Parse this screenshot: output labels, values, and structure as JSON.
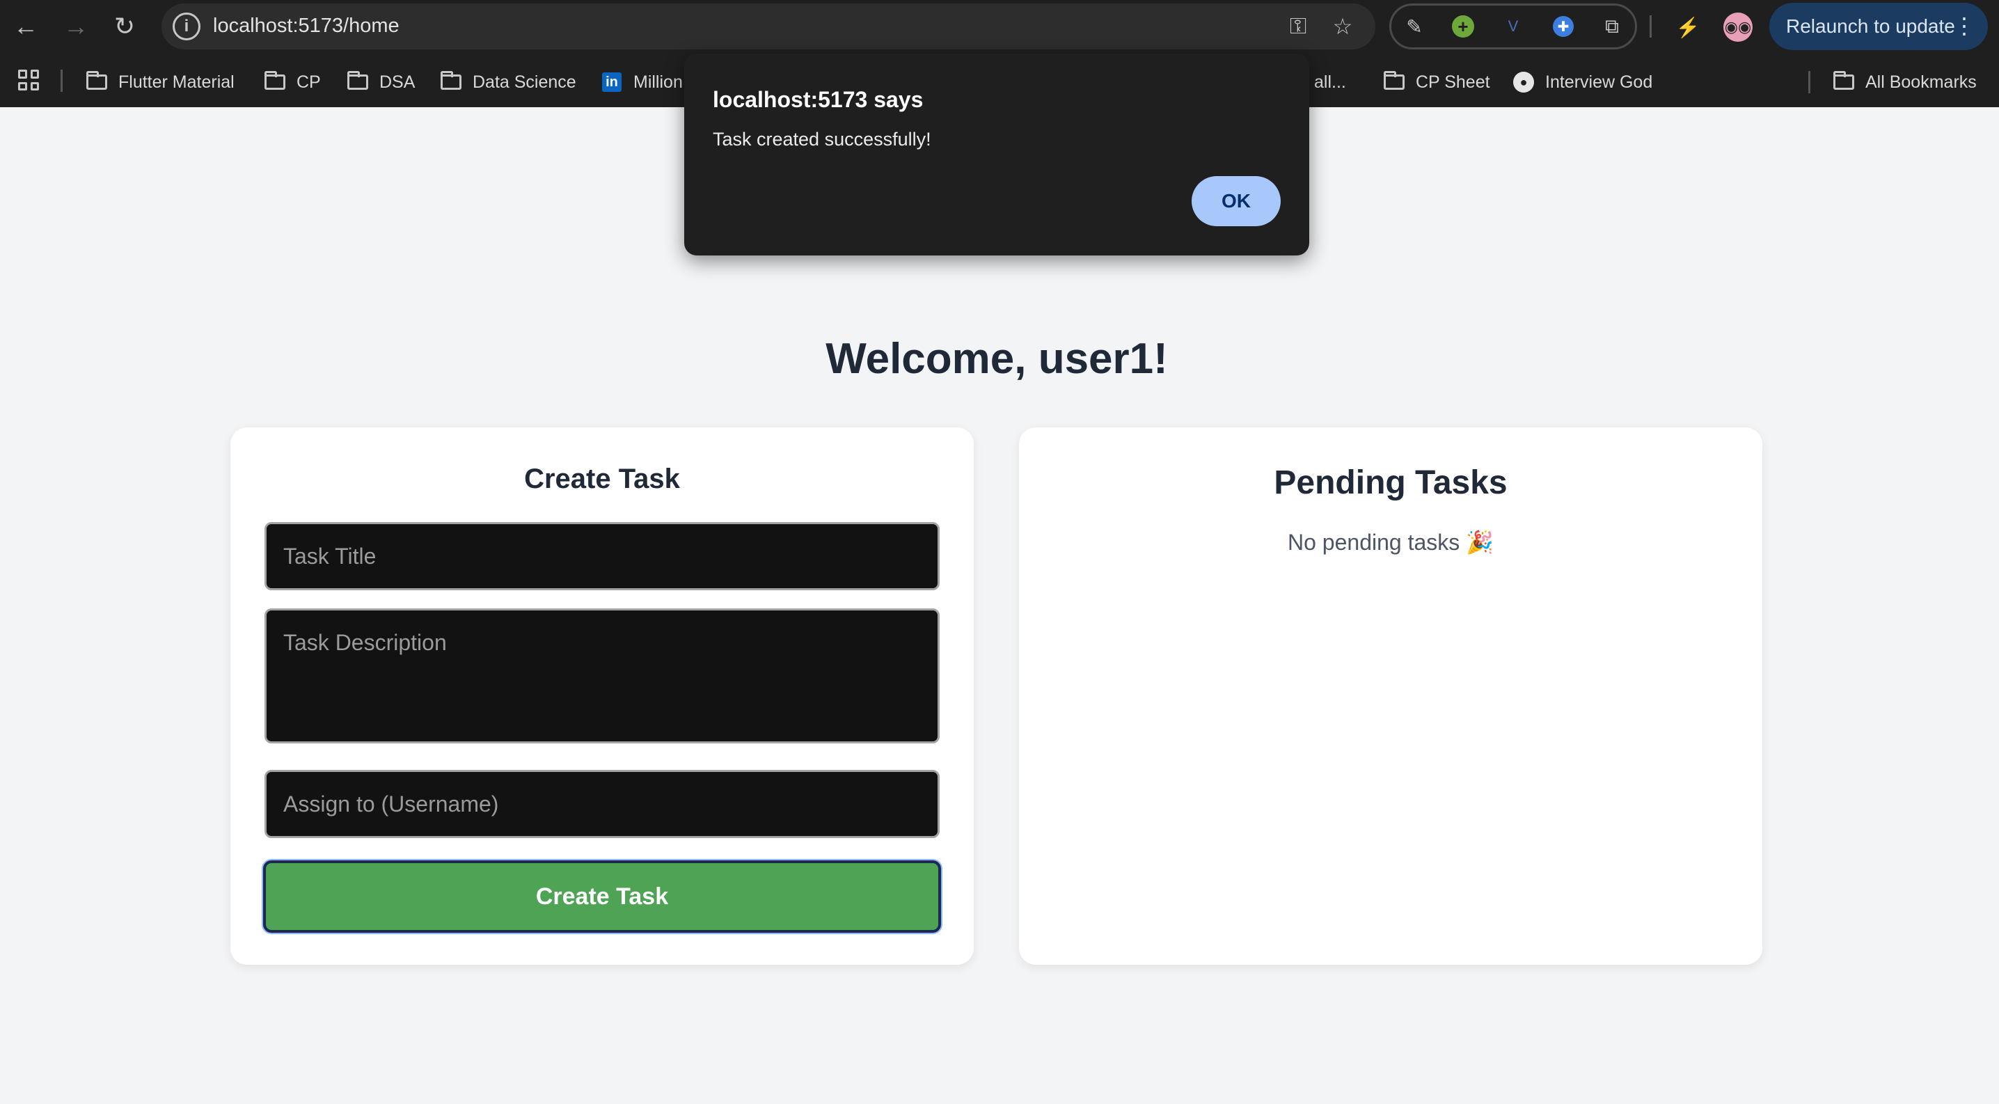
{
  "browser": {
    "url": "localhost:5173/home",
    "relaunch_label": "Relaunch to update",
    "bookmarks": [
      {
        "label": "Flutter Material",
        "icon": "folder-icon"
      },
      {
        "label": "CP",
        "icon": "folder-icon"
      },
      {
        "label": "DSA",
        "icon": "folder-icon"
      },
      {
        "label": "Data Science",
        "icon": "folder-icon"
      },
      {
        "label": "Million",
        "icon": "linkedin-icon"
      },
      {
        "label": "all...",
        "icon": "none"
      },
      {
        "label": "CP Sheet",
        "icon": "folder-icon"
      },
      {
        "label": "Interview God",
        "icon": "github-icon"
      }
    ],
    "all_bookmarks_label": "All Bookmarks"
  },
  "dialog": {
    "title": "localhost:5173 says",
    "message": "Task created successfully!",
    "ok_label": "OK"
  },
  "page": {
    "welcome": "Welcome, user1!",
    "create_task": {
      "title": "Create Task",
      "title_placeholder": "Task Title",
      "description_placeholder": "Task Description",
      "assign_placeholder": "Assign to (Username)",
      "button_label": "Create Task"
    },
    "pending_tasks": {
      "title": "Pending Tasks",
      "empty_message": "No pending tasks 🎉"
    }
  },
  "colors": {
    "chrome_bg": "#1f1f1f",
    "page_bg": "#f3f4f6",
    "button_green": "#4ea354",
    "dialog_ok_bg": "#a8c7fa",
    "relaunch_bg": "#1b3b61"
  }
}
